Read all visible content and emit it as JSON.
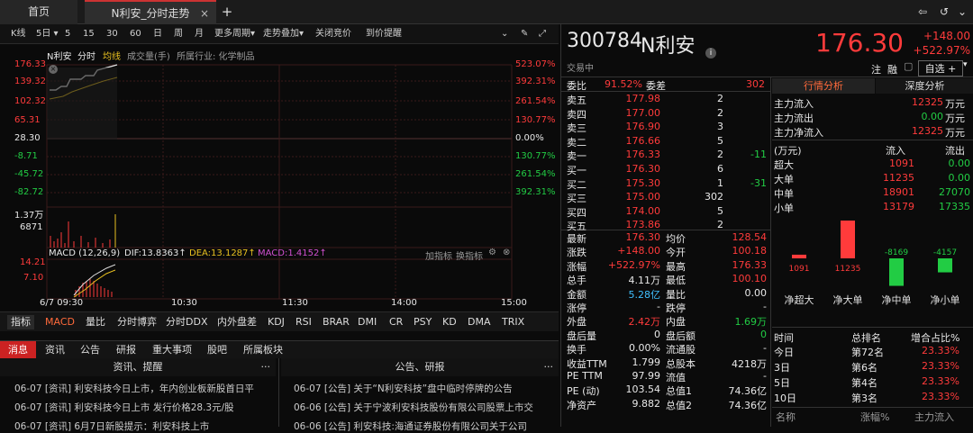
{
  "tabs": {
    "home": "首页",
    "stock": "N利安_分时走势",
    "add": "+"
  },
  "toolbar": {
    "k": "K线",
    "day5": "5日",
    "five": "5",
    "fifteen": "15",
    "thirty": "30",
    "sixty": "60",
    "day": "日",
    "week": "周",
    "month": "月",
    "more": "更多周期",
    "overlay": "走势叠加",
    "close_auction": "关闭竞价",
    "reminder": "到价提醒"
  },
  "chart": {
    "name": "N利安",
    "mode": "分时",
    "avg": "均线",
    "vol": "成交量(手)",
    "industry": "所属行业: 化学制品",
    "prices": [
      "176.33",
      "139.32",
      "102.32",
      "65.31",
      "28.30",
      "-8.71",
      "-45.72",
      "-82.72"
    ],
    "pcts": [
      "523.07%",
      "392.31%",
      "261.54%",
      "130.77%",
      "0.00%",
      "130.77%",
      "261.54%",
      "392.31%"
    ],
    "vol_labels": [
      "1.37万",
      "6871"
    ],
    "macd_title": "MACD (12,26,9)",
    "dif": "DIF:13.8363↑",
    "dea": "DEA:13.1287↑",
    "macd": "MACD:1.4152↑",
    "macd_labels": [
      "14.21",
      "7.10"
    ],
    "add_ind": "加指标",
    "swap_ind": "换指标",
    "times": [
      "6/7  09:30",
      "10:30",
      "11:30",
      "14:00",
      "15:00"
    ]
  },
  "indicators": [
    "指标",
    "MACD",
    "量比",
    "分时博弈",
    "分时DDX",
    "内外盘差",
    "KDJ",
    "RSI",
    "BRAR",
    "DMI",
    "CR",
    "PSY",
    "KD",
    "DMA",
    "TRIX"
  ],
  "newstabs": [
    "消息",
    "资讯",
    "公告",
    "研报",
    "重大事项",
    "股吧",
    "所属板块"
  ],
  "news_left_head": "资讯、提醒",
  "news_right_head": "公告、研报",
  "news_left": [
    "06-07 [资讯] 利安科技今日上市，年内创业板新股首日平",
    "06-07 [资讯] 利安科技今日上市 发行价格28.3元/股",
    "06-07 [资讯] 6月7日新股提示：利安科技上市"
  ],
  "news_right": [
    "06-07 [公告] 关于“N利安科技”盘中临时停牌的公告",
    "06-06 [公告] 关于宁波利安科技股份有限公司股票上市交",
    "06-06 [公告] 利安科技:海通证券股份有限公司关于公司"
  ],
  "quote": {
    "code": "300784",
    "name": "N利安",
    "status": "交易中",
    "price": "176.30",
    "chg": "+148.00",
    "pct": "+522.97%",
    "note": "注",
    "finance": "融",
    "select": "自选 +",
    "weibi_label": "委比",
    "weibi": "91.52%",
    "weicha_label": "委差",
    "weicha": "302",
    "sells": [
      [
        "卖五",
        "177.98",
        "2",
        ""
      ],
      [
        "卖四",
        "177.00",
        "2",
        ""
      ],
      [
        "卖三",
        "176.90",
        "3",
        ""
      ],
      [
        "卖二",
        "176.66",
        "5",
        ""
      ],
      [
        "卖一",
        "176.33",
        "2",
        "-11"
      ]
    ],
    "buys": [
      [
        "买一",
        "176.30",
        "6",
        ""
      ],
      [
        "买二",
        "175.30",
        "1",
        "-31"
      ],
      [
        "买三",
        "175.00",
        "302",
        ""
      ],
      [
        "买四",
        "174.00",
        "5",
        ""
      ],
      [
        "买五",
        "173.86",
        "2",
        ""
      ]
    ],
    "stats": [
      [
        "最新",
        "176.30",
        "均价",
        "128.54"
      ],
      [
        "涨跌",
        "+148.00",
        "今开",
        "100.18"
      ],
      [
        "涨幅",
        "+522.97%",
        "最高",
        "176.33"
      ],
      [
        "总手",
        "4.11万",
        "最低",
        "100.10"
      ],
      [
        "金额",
        "5.28亿",
        "量比",
        "0.00"
      ],
      [
        "涨停",
        "-",
        "跌停",
        "-"
      ],
      [
        "外盘",
        "2.42万",
        "内盘",
        "1.69万"
      ],
      [
        "盘后量",
        "0",
        "盘后额",
        "0"
      ],
      [
        "换手",
        "0.00%",
        "流通股",
        "-"
      ],
      [
        "收益TTM",
        "1.799",
        "总股本",
        "4218万"
      ],
      [
        "PE TTM",
        "97.99",
        "流值",
        "-"
      ],
      [
        "PE (动)",
        "103.54",
        "总值1",
        "74.36亿"
      ],
      [
        "净资产",
        "9.882",
        "总值2",
        "74.36亿"
      ]
    ]
  },
  "flow": {
    "tab1": "行情分析",
    "tab2": "深度分析",
    "main_in_label": "主力流入",
    "main_in": "12325",
    "main_out_label": "主力流出",
    "main_out": "0.00",
    "main_net_label": "主力净流入",
    "main_net": "12325",
    "unit": "万元",
    "col0": "(万元)",
    "col1": "流入",
    "col2": "流出",
    "rows": [
      [
        "超大",
        "1091",
        "0.00"
      ],
      [
        "大单",
        "11235",
        "0.00"
      ],
      [
        "中单",
        "18901",
        "27070"
      ],
      [
        "小单",
        "13179",
        "17335"
      ]
    ],
    "bars": [
      {
        "label": "净超大",
        "value": 1091
      },
      {
        "label": "净大单",
        "value": 11235
      },
      {
        "label": "净中单",
        "value": -8169
      },
      {
        "label": "净小单",
        "value": -4157
      }
    ],
    "rank_head": [
      "时间",
      "总排名",
      "增合占比%"
    ],
    "ranks": [
      [
        "今日",
        "第72名",
        "23.33%"
      ],
      [
        "3日",
        "第6名",
        "23.33%"
      ],
      [
        "5日",
        "第4名",
        "23.33%"
      ],
      [
        "10日",
        "第3名",
        "23.33%"
      ]
    ],
    "footer": [
      "名称",
      "涨幅%",
      "主力流入"
    ]
  },
  "colors": {
    "up": "#ff3b3b",
    "down": "#22cc44",
    "accent": "#e8c020"
  }
}
